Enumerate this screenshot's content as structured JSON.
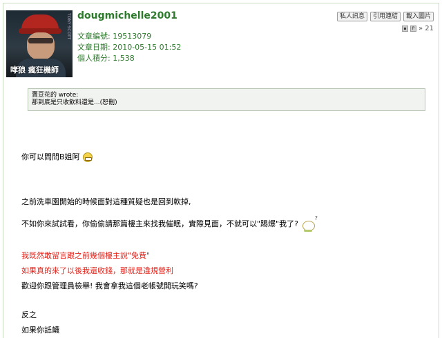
{
  "post": {
    "username": "dougmichelle2001",
    "article_no": "文章編號: 19513079",
    "article_date": "文章日期: 2010-05-15 01:52",
    "points": "個人積分: 1,538",
    "avatar_caption": "哮狼 瘋狂機師",
    "avatar_side_text": "TONY·SCOTT"
  },
  "actions": {
    "private_msg": "私人訊息",
    "quote_link": "引用連結",
    "upload_image": "載入圖片",
    "reply_count": "» 21"
  },
  "quote": {
    "author": "賣豆花的 wrote:",
    "text": "那到底是只收飲料還是...(恕刪)"
  },
  "content": {
    "line1": "你可以問問B姐阿",
    "line2": "之前洗車園開始的時候面對這種質疑也是回到軟掉,",
    "line3": "不如你來試試看，你偷偷請那篇樓主來找我催眠，實際見面，不就可以\"踢爆\"我了?",
    "line4": "我既然敢留言跟之前幾個樓主說\"免費\"",
    "line5": "如果真的來了以後我還收錢，那就是違規營利",
    "line6": "歡迎你跟管理員檢舉! 我會拿我這個老帳號開玩笑嗎?",
    "line7": "反之",
    "line8": "如果你詆衊"
  },
  "colors": {
    "username": "#2d7a2d",
    "warning": "#e2231a"
  }
}
